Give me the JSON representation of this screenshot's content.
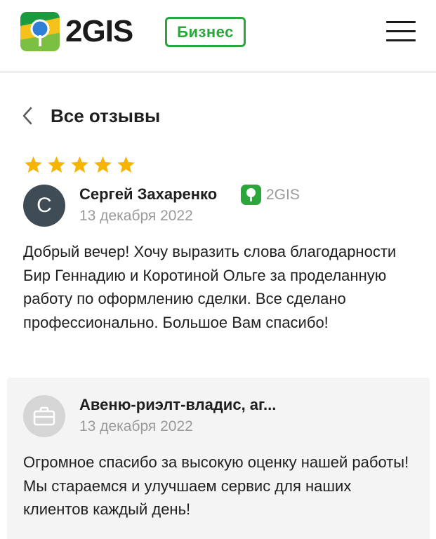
{
  "header": {
    "logo_text": "2GIS",
    "business_badge": "Бизнес",
    "menu_icon": "hamburger-menu-icon"
  },
  "page": {
    "back_icon": "chevron-left-icon",
    "title": "Все отзывы"
  },
  "review": {
    "rating": 5,
    "rating_max": 5,
    "star_color": "#f5b400",
    "author_initial": "С",
    "author_name": "Сергей Захаренко",
    "source_label": "2GIS",
    "date": "13 декабря 2022",
    "text": "Добрый вечер! Хочу выразить слова благодарности Бир Геннадию и Коротиной Ольге за проделанную работу по оформлению сделки. Все сделано профессионально. Большое Вам спасибо!"
  },
  "reply": {
    "avatar_icon": "briefcase-icon",
    "company_name": "Авеню-риэлт-владис, аг...",
    "date": "13 декабря 2022",
    "text": "Огромное спасибо за высокую оценку нашей работы! Мы стараемся и улучшаем сервис для наших клиентов каждый день!"
  },
  "colors": {
    "brand_green": "#2aa63a",
    "avatar_dark": "#3f4b55",
    "muted_text": "#9a9a9a",
    "reply_bg": "#f4f4f4"
  }
}
